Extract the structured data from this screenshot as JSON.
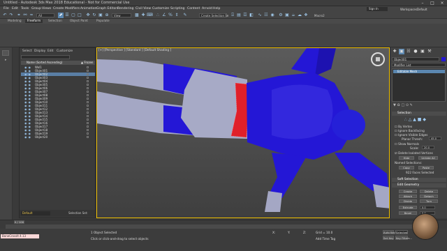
{
  "window": {
    "title": "Untitled - Autodesk 3ds Max 2018 Educational - Not for Commercial Use",
    "workspace_label": "Workspaces:",
    "workspace_value": "Default",
    "sign_in": "Sign In"
  },
  "menu": [
    "File",
    "Edit",
    "Tools",
    "Group",
    "Views",
    "Create",
    "Modifiers",
    "Animation",
    "Graph Editors",
    "Rendering",
    "Civil View",
    "Customize",
    "Scripting",
    "Content",
    "Arnold",
    "Help"
  ],
  "toolbar": {
    "view_dropdown": "All",
    "ref_coord": "View",
    "selection_set": "Create Selection Se",
    "macro": "Macro2"
  },
  "ribbon": {
    "tabs": [
      "Modeling",
      "Freeform",
      "Selection",
      "Object Paint",
      "Populate"
    ],
    "active": "Freeform"
  },
  "explorer": {
    "tabs": [
      "Select",
      "Display",
      "Edit",
      "Customize"
    ],
    "column_name": "Name (Sorted Ascending)",
    "column_frozen": "▲ Frozen",
    "objects": [
      "Wol1",
      "Object01",
      "Object02",
      "Object03",
      "Object04",
      "Object05",
      "Object06",
      "Object07",
      "Object08",
      "Object09",
      "Object10",
      "Object11",
      "Object12",
      "Object13",
      "Object14",
      "Object15",
      "Object16",
      "Object17",
      "Object18",
      "Object19",
      "Object20"
    ],
    "layer": "Default",
    "selection_set_label": "Selection Set:"
  },
  "viewport": {
    "label": "[+] [Perspective ] [Standard ] [Default Shading ]"
  },
  "command_panel": {
    "object_name": "Object01",
    "modifier_list": "Modifier List",
    "stack_item": "Editable Mesh",
    "rollouts": {
      "selection": "Selection",
      "soft_selection": "Soft Selection",
      "edit_geometry": "Edit Geometry"
    },
    "options": [
      "By Vertex",
      "Ignore Backfacing",
      "Ignore Visible Edges"
    ],
    "planar_thresh_label": "Planar Thresh:",
    "planar_thresh_value": "45.0",
    "show_normals": "Show Normals",
    "scale_label": "Scale:",
    "scale_value": "20.0",
    "delete_isolated": "Delete Isolated Vertices",
    "hide": "Hide",
    "unhide_all": "Unhide All",
    "named_selections": "Named Selections:",
    "copy": "Copy",
    "paste": "Paste",
    "faces_selected": "922 Faces Selected",
    "edit_buttons": [
      [
        "Create",
        "Delete"
      ],
      [
        "Attach",
        "Detach"
      ],
      [
        "Divide",
        "Turn"
      ],
      [
        "Extrude",
        "0.0"
      ],
      [
        "Bevel",
        "0.0"
      ]
    ]
  },
  "timeline": {
    "frame": "0 / 100"
  },
  "status": {
    "maxscript": "BoneCrossIt  4.13",
    "objects_selected": "1 Object Selected",
    "prompt": "Click or click-and-drag to select objects",
    "x_label": "X:",
    "y_label": "Y:",
    "z_label": "Z:",
    "grid": "Grid = 10.0",
    "add_time_tag": "Add Time Tag",
    "auto_key": "Auto Key",
    "set_key": "Set Key",
    "selected": "Selected",
    "key_filters": "Key Filters..."
  },
  "colors": {
    "mesh_blue": "#2417d6",
    "mesh_gray": "#a4a7c4",
    "selected_faces": "#e0202a",
    "accent": "#f0c000"
  }
}
